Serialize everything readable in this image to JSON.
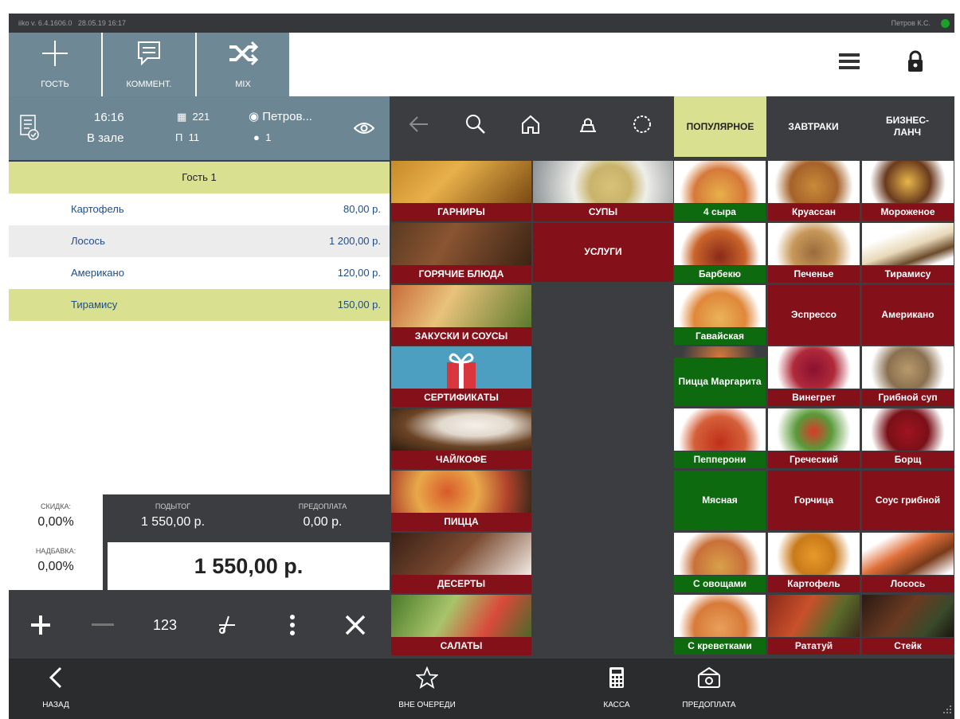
{
  "status": {
    "version": "iiko v. 6.4.1606.0",
    "datetime": "28.05.19 16:17",
    "user": "Петров К.С."
  },
  "toolbar": {
    "guest_label": "ГОСТЬ",
    "comment_label": "КОММЕНТ.",
    "mix_label": "MIX"
  },
  "order": {
    "time": "16:16",
    "location": "В зале",
    "order_number": "221",
    "table": "11",
    "waiter": "Петров...",
    "guests_count": "1",
    "guest_label": "Гость 1",
    "items": [
      {
        "name": "Картофель",
        "price": "80,00 р."
      },
      {
        "name": "Лосось",
        "price": "1 200,00 р."
      },
      {
        "name": "Американо",
        "price": "120,00 р."
      },
      {
        "name": "Тирамису",
        "price": "150,00 р."
      }
    ],
    "discount_label": "СКИДКА:",
    "discount_value": "0,00%",
    "surcharge_label": "НАДБАВКА:",
    "surcharge_value": "0,00%",
    "subtotal_label": "ПОДЫТОГ",
    "subtotal_value": "1 550,00 р.",
    "prepay_label": "ПРЕДОПЛАТА",
    "prepay_value": "0,00 р.",
    "total": "1 550,00 р."
  },
  "actions": {
    "numpad_label": "123"
  },
  "categories": [
    "ГАРНИРЫ",
    "СУПЫ",
    "ГОРЯЧИЕ БЛЮДА",
    "УСЛУГИ",
    "ЗАКУСКИ И СОУСЫ",
    "СЕРТИФИКАТЫ",
    "ЧАЙ/КОФЕ",
    "ПИЦЦА",
    "ДЕСЕРТЫ",
    "САЛАТЫ"
  ],
  "tabs": [
    "ПОПУЛЯРНОЕ",
    "ЗАВТРАКИ",
    "БИЗНЕС-ЛАНЧ"
  ],
  "products": [
    "4 сыра",
    "Круассан",
    "Мороженое",
    "Барбекю",
    "Печенье",
    "Тирамису",
    "Гавайская",
    "Эспрессо",
    "Американо",
    "Пицца Маргарита",
    "Винегрет",
    "Грибной суп",
    "Пепперони",
    "Греческий",
    "Борщ",
    "Мясная",
    "Горчица",
    "Соус грибной",
    "С овощами",
    "Картофель",
    "Лосось",
    "С креветками",
    "Рататуй",
    "Стейк"
  ],
  "bottom": {
    "back_label": "НАЗАД",
    "queue_label": "ВНЕ ОЧЕРЕДИ",
    "cash_label": "КАССА",
    "prepay_label": "ПРЕДОПЛАТА"
  },
  "colors": {
    "accent_yellow": "#d9e08f",
    "tile_red": "#84101a",
    "tile_green": "#0e6a0e",
    "header_slate": "#6d8694"
  }
}
